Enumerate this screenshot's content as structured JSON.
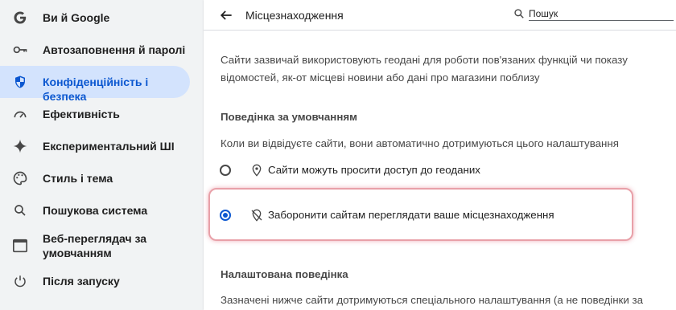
{
  "sidebar": {
    "items": [
      {
        "label": "Ви й Google",
        "icon": "google-g-icon",
        "active": false
      },
      {
        "label": "Автозаповнення й паролі",
        "icon": "key-icon",
        "active": false
      },
      {
        "label": "Конфіденційність і безпека",
        "icon": "shield-icon",
        "active": true
      },
      {
        "label": "Ефективність",
        "icon": "speedometer-icon",
        "active": false
      },
      {
        "label": "Експериментальний ШІ",
        "icon": "sparkle-icon",
        "active": false
      },
      {
        "label": "Стиль і тема",
        "icon": "palette-icon",
        "active": false
      },
      {
        "label": "Пошукова система",
        "icon": "search-icon",
        "active": false
      },
      {
        "label": "Веб-переглядач за умовчанням",
        "icon": "browser-window-icon",
        "active": false
      },
      {
        "label": "Після запуску",
        "icon": "power-icon",
        "active": false
      }
    ]
  },
  "header": {
    "title": "Місцезнаходження",
    "search_placeholder": "Пошук"
  },
  "main": {
    "description": "Сайти зазвичай використовують геодані для роботи пов'язаних функцій чи показу відомостей, як-от місцеві новини або дані про магазини поблизу",
    "default_behavior": {
      "heading": "Поведінка за умовчанням",
      "subtext": "Коли ви відвідуєте сайти, вони автоматично дотримуються цього налаштування",
      "options": [
        {
          "label": "Сайти можуть просити доступ до геоданих",
          "icon": "location-pin-icon",
          "checked": false
        },
        {
          "label": "Заборонити сайтам переглядати ваше місцезнаходження",
          "icon": "location-off-icon",
          "checked": true
        }
      ]
    },
    "custom_behavior": {
      "heading": "Налаштована поведінка",
      "subtext": "Зазначені нижче сайти дотримуються спеціального налаштування (а не поведінки за"
    }
  },
  "colors": {
    "accent": "#0b57d0",
    "active_bg": "#d3e3fd",
    "highlight_border": "#e8a0a8"
  }
}
